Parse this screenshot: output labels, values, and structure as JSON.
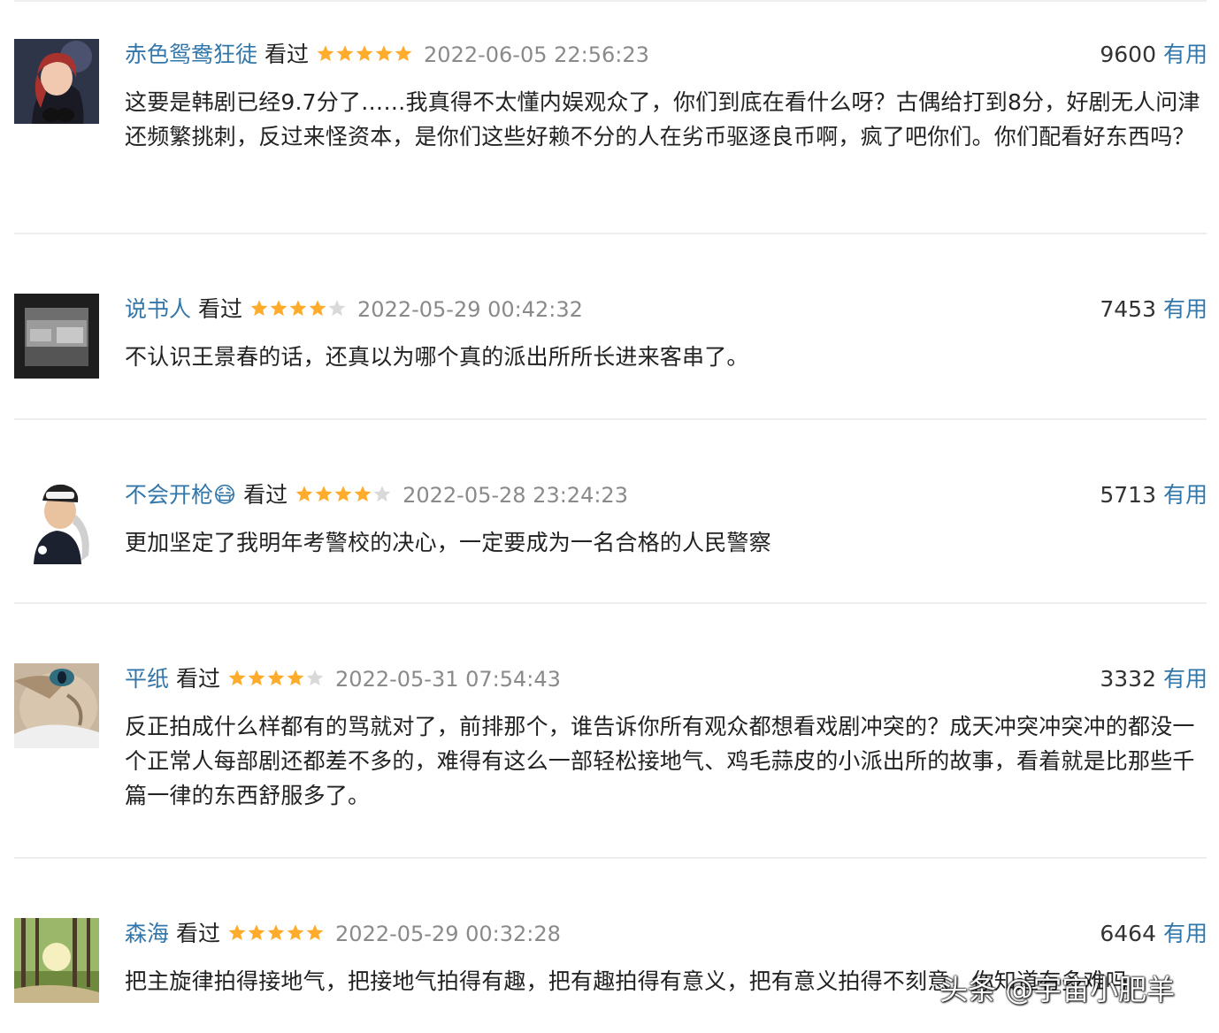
{
  "reviews": [
    {
      "username": "赤色鸳鸯狂徒",
      "status": "看过",
      "rating": 5,
      "date": "2022-06-05 22:56:23",
      "votes": "9600",
      "helpful": "有用",
      "content": "这要是韩剧已经9.7分了……我真得不太懂内娱观众了，你们到底在看什么呀？古偶给打到8分，好剧无人问津还频繁挑刺，反过来怪资本，是你们这些好赖不分的人在劣币驱逐良币啊，疯了吧你们。你们配看好东西吗？"
    },
    {
      "username": "说书人",
      "status": "看过",
      "rating": 4,
      "date": "2022-05-29 00:42:32",
      "votes": "7453",
      "helpful": "有用",
      "content": "不认识王景春的话，还真以为哪个真的派出所所长进来客串了。"
    },
    {
      "username": "不会开枪😷",
      "status": "看过",
      "rating": 4,
      "date": "2022-05-28 23:24:23",
      "votes": "5713",
      "helpful": "有用",
      "content": "更加坚定了我明年考警校的决心，一定要成为一名合格的人民警察"
    },
    {
      "username": "平纸",
      "status": "看过",
      "rating": 4,
      "date": "2022-05-31 07:54:43",
      "votes": "3332",
      "helpful": "有用",
      "content": "反正拍成什么样都有的骂就对了，前排那个，谁告诉你所有观众都想看戏剧冲突的？成天冲突冲突冲的都没一个正常人每部剧还都差不多的，难得有这么一部轻松接地气、鸡毛蒜皮的小派出所的故事，看着就是比那些千篇一律的东西舒服多了。"
    },
    {
      "username": "森海",
      "status": "看过",
      "rating": 5,
      "date": "2022-05-29 00:32:28",
      "votes": "6464",
      "helpful": "有用",
      "content": "把主旋律拍得接地气，把接地气拍得有趣，把有趣拍得有意义，把有意义拍得不刻意，你知道有多难吗"
    }
  ],
  "watermark": "头条 @宇宙小肥羊",
  "colors": {
    "username": "#3377aa",
    "star_filled": "#ffac2d",
    "star_empty": "#d9d9d9",
    "date": "#8a8a8a",
    "divider": "#eeeeee"
  },
  "icons": {
    "star": "star-icon",
    "avatar": "avatar-image"
  }
}
